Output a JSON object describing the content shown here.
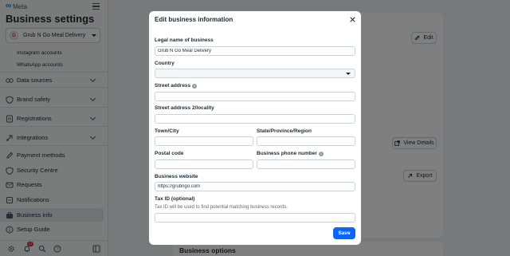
{
  "sidebar": {
    "brand": "Meta",
    "title": "Business settings",
    "business_select": {
      "avatar_text": "G",
      "value": "Grub N Go Meal Delivery"
    },
    "sub_items": [
      "Instagram accounts",
      "WhatsApp accounts"
    ],
    "nav": [
      {
        "label": "Data sources",
        "icon": "data-sources-icon",
        "expandable": true
      },
      {
        "label": "Brand safety",
        "icon": "shield-icon",
        "expandable": true
      },
      {
        "label": "Registrations",
        "icon": "registrations-icon",
        "expandable": true
      },
      {
        "label": "Integrations",
        "icon": "integrations-icon",
        "expandable": true
      },
      {
        "label": "Payment methods",
        "icon": "pencil-icon",
        "expandable": false
      },
      {
        "label": "Security Centre",
        "icon": "shield-icon",
        "expandable": false
      },
      {
        "label": "Requests",
        "icon": "requests-icon",
        "expandable": false
      },
      {
        "label": "Notifications",
        "icon": "bell-icon",
        "expandable": false
      },
      {
        "label": "Business info",
        "icon": "briefcase-icon",
        "expandable": false,
        "active": true
      },
      {
        "label": "Setup Guide",
        "icon": "info-icon",
        "expandable": false
      }
    ],
    "bottom_bar": {
      "notifications_badge": "12"
    }
  },
  "background": {
    "edit_label": "Edit",
    "view_details_label": "View Details",
    "export_label": "Export",
    "business_options_title": "Business options"
  },
  "modal": {
    "title": "Edit business information",
    "legal_name": {
      "label": "Legal name of business",
      "value": "Grub N Go Meal Delivery"
    },
    "country": {
      "label": "Country",
      "value": ""
    },
    "street_address": {
      "label": "Street address",
      "value": ""
    },
    "street_address_2": {
      "label": "Street address 2/locality",
      "value": ""
    },
    "town_city": {
      "label": "Town/City",
      "value": ""
    },
    "state": {
      "label": "State/Province/Region",
      "value": ""
    },
    "postal_code": {
      "label": "Postal code",
      "value": ""
    },
    "phone": {
      "label": "Business phone number",
      "value": ""
    },
    "website": {
      "label": "Business website",
      "value": "https://grubngo.com"
    },
    "tax_id": {
      "label": "Tax ID (optional)",
      "help": "Tax ID will be used to find potential matching business records.",
      "value": ""
    },
    "save_label": "Save"
  },
  "colors": {
    "primary": "#0866ff",
    "text": "#1c2b33",
    "badge": "#e41e3f"
  }
}
